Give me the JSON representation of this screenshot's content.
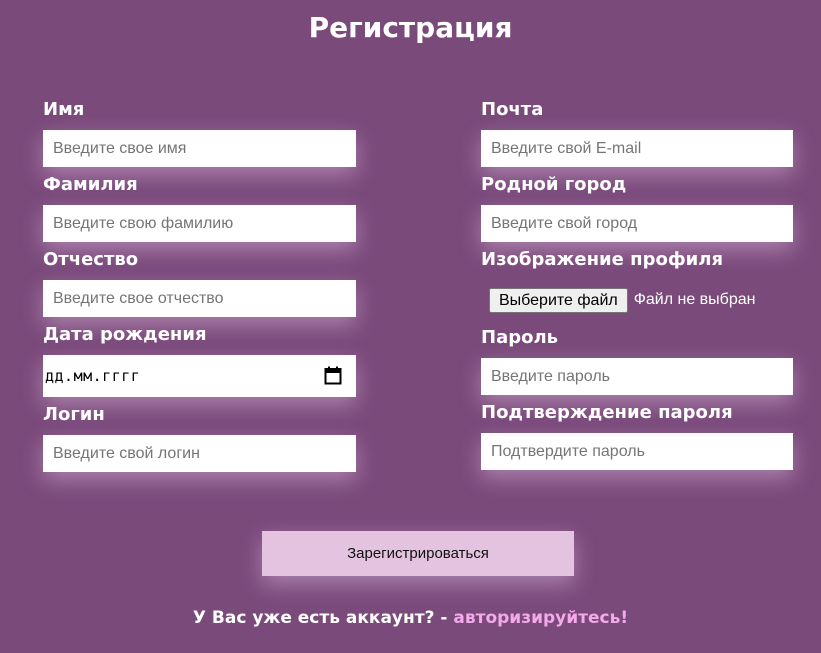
{
  "page": {
    "title": "Регистрация"
  },
  "form": {
    "left": {
      "first_name": {
        "label": "Имя",
        "placeholder": "Введите свое имя"
      },
      "last_name": {
        "label": "Фамилия",
        "placeholder": "Введите свою фамилию"
      },
      "patronymic": {
        "label": "Отчество",
        "placeholder": "Введите свое отчество"
      },
      "birth_date": {
        "label": "Дата рождения",
        "display": "дд.мм.гггг",
        "icon": "calendar-icon"
      },
      "login": {
        "label": "Логин",
        "placeholder": "Введите свой логин"
      }
    },
    "right": {
      "email": {
        "label": "Почта",
        "placeholder": "Введите свой E-mail"
      },
      "city": {
        "label": "Родной город",
        "placeholder": "Введите свой город"
      },
      "avatar": {
        "label": "Изображение профиля",
        "button": "Выберите файл",
        "status": "Файл не выбран"
      },
      "password": {
        "label": "Пароль",
        "placeholder": "Введите пароль"
      },
      "password_confirm": {
        "label": "Подтверждение пароля",
        "placeholder": "Подтвердите пароль"
      }
    },
    "submit_label": "Зарегистрироваться"
  },
  "footer": {
    "text": "У Вас уже есть аккаунт? - ",
    "link": "авторизируйтесь!"
  },
  "colors": {
    "background": "#7a4a7b",
    "submit": "#e3c3df",
    "link": "#f3a9ea"
  }
}
